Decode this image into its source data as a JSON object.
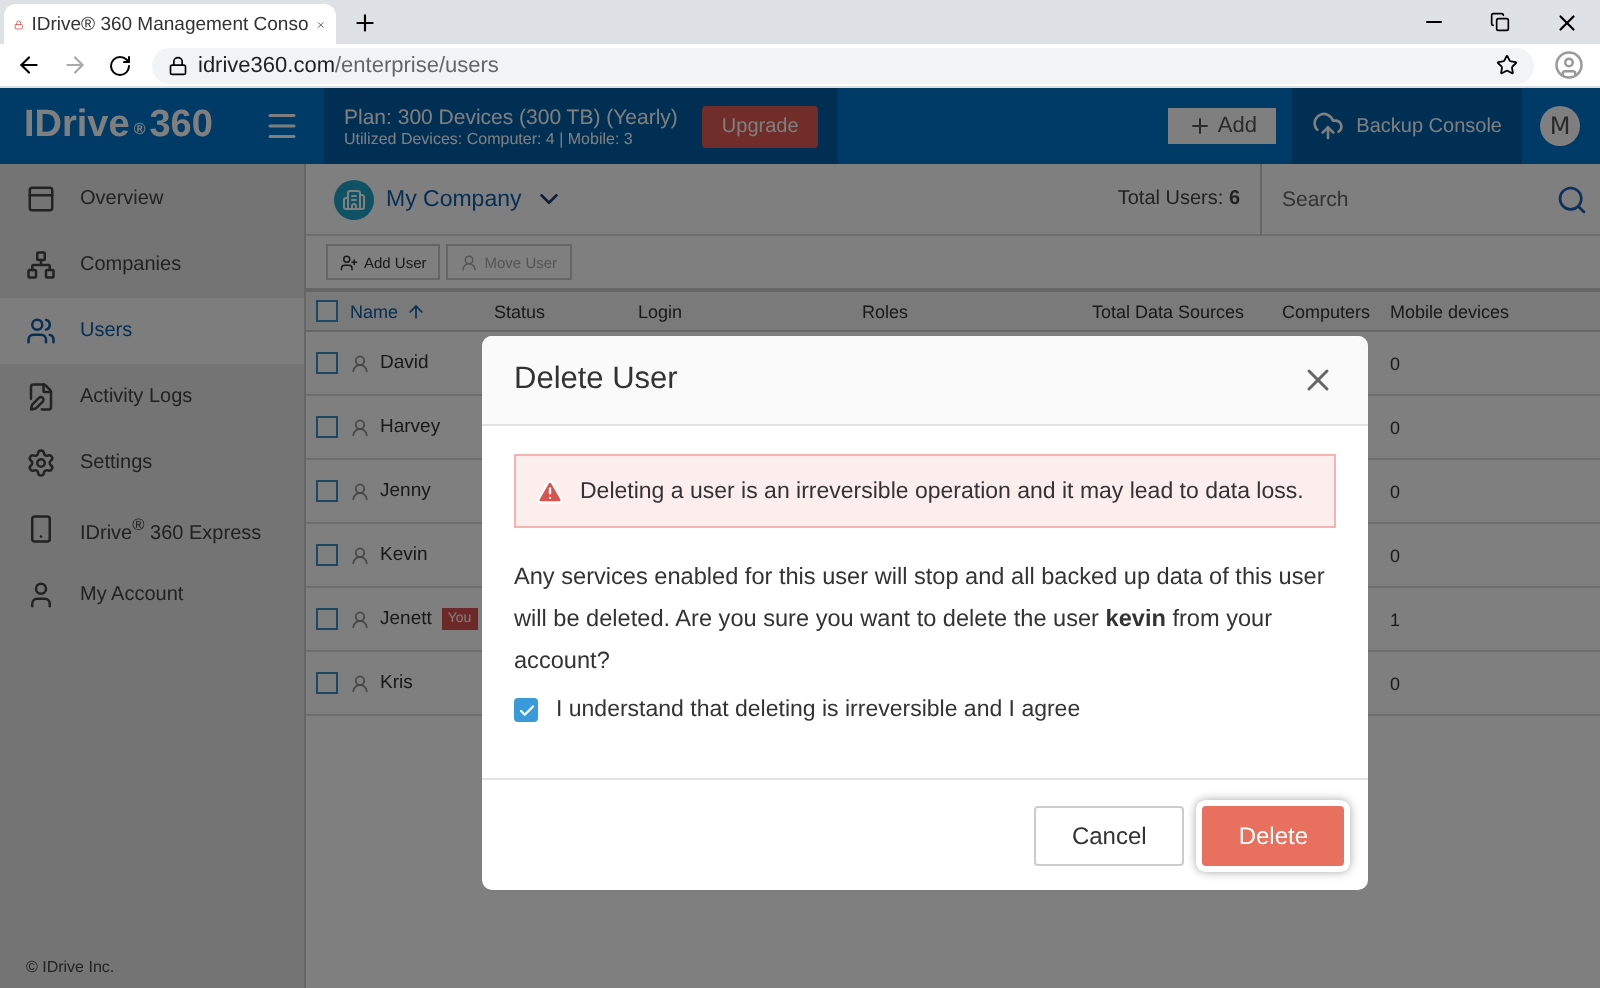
{
  "browser": {
    "tab_title": "IDrive® 360 Management Conso",
    "url_host": "idrive360.com",
    "url_path": "/enterprise/users"
  },
  "header": {
    "logo_name": "IDrive",
    "logo_mark": "®",
    "logo_number": "360",
    "plan": "Plan: 300 Devices (300 TB) (Yearly)",
    "utilized": "Utilized Devices: Computer: 4 |  Mobile: 3",
    "upgrade": "Upgrade",
    "add": "Add",
    "backup_console": "Backup Console",
    "avatar": "M"
  },
  "sidebar": {
    "items": [
      {
        "label": "Overview",
        "selected": false
      },
      {
        "label": "Companies",
        "selected": false
      },
      {
        "label": "Users",
        "selected": true
      },
      {
        "label": "Activity Logs",
        "selected": false
      },
      {
        "label": "Settings",
        "selected": false
      },
      {
        "label": "IDrive$^{®}$ 360 Express",
        "selected": false
      },
      {
        "label": "My Account",
        "selected": false
      }
    ],
    "footer": "© IDrive Inc."
  },
  "toolbar": {
    "company": "My Company",
    "total_users_label": "Total Users:",
    "total_users_value": "6",
    "search": {
      "placeholder": "Search"
    }
  },
  "actions": [
    {
      "label": "Add User",
      "disabled": false
    },
    {
      "label": "Move User",
      "disabled": true
    }
  ],
  "table": {
    "select_all_checked": false,
    "columns": [
      "Name",
      "Status",
      "Login",
      "Roles",
      "Total Data Sources",
      "Computers",
      "Mobile devices"
    ],
    "rows": [
      {
        "name": "David",
        "checked": false,
        "mobile": "0"
      },
      {
        "name": "Harvey",
        "checked": false,
        "mobile": "0"
      },
      {
        "name": "Jenny",
        "checked": false,
        "mobile": "0"
      },
      {
        "name": "Kevin",
        "checked": false,
        "mobile": "0"
      },
      {
        "name": "Jenett",
        "checked": false,
        "badge": "You",
        "mobile": "1"
      },
      {
        "name": "Kris",
        "checked": false,
        "mobile": "0"
      }
    ]
  },
  "dialog": {
    "title": "Delete User",
    "warning": "Deleting a user is an irreversible operation and it may lead to data loss.",
    "message": "Any services enabled for this user will stop and all backed up data of this user will be deleted. Are you sure you want to delete the user **kevin** from your account?",
    "agree": {
      "label": "I understand that deleting is irreversible and I agree",
      "checked": true
    },
    "buttons": [
      {
        "label": "Cancel",
        "kind": "secondary"
      },
      {
        "label": "Delete",
        "kind": "danger"
      }
    ]
  }
}
